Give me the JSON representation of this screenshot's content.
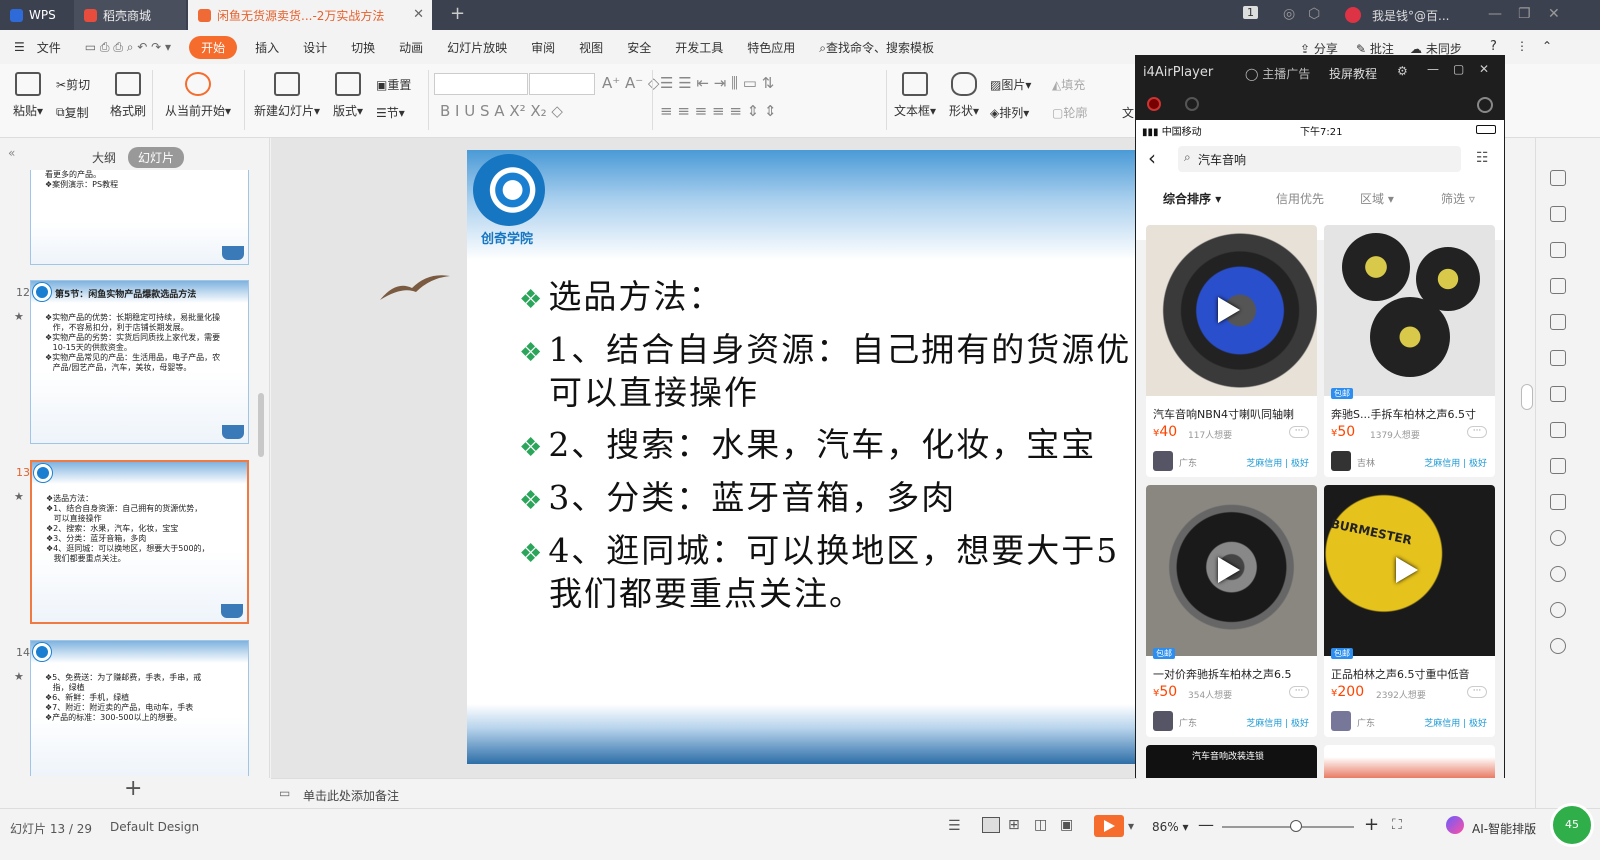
{
  "tabs": {
    "wps": "WPS",
    "store": "稻壳商城",
    "doc": "闲鱼无货源卖货...-2万实战方法"
  },
  "titlebar": {
    "user": "我是钱°@百...",
    "badge": "1"
  },
  "menu": {
    "file": "文件",
    "items": [
      "开始",
      "插入",
      "设计",
      "切换",
      "动画",
      "幻灯片放映",
      "审阅",
      "视图",
      "安全",
      "开发工具",
      "特色应用"
    ],
    "search": "查找命令、搜索模板",
    "share": "分享",
    "comment": "批注",
    "sync": "未同步"
  },
  "ribbon": {
    "paste": "粘贴",
    "cut": "剪切",
    "copy": "复制",
    "format_painter": "格式刷",
    "from_current": "从当前开始",
    "new_slide": "新建幻灯片",
    "layout": "版式",
    "reset": "重置",
    "section": "节",
    "textbox": "文本框",
    "shape": "形状",
    "picture": "图片",
    "arrange": "排列",
    "fill": "填充",
    "outline": "轮廓",
    "wen": "文"
  },
  "panel": {
    "outline_tab": "大纲",
    "slides_tab": "幻灯片",
    "slide11_lines": "看更多的产品。\n❖案例演示：PS教程",
    "slide12_num": "12",
    "slide12_title": "第5节：闲鱼实物产品爆款选品方法",
    "slide12_lines": "❖实物产品的优势：长期稳定可持续，易批量化操\n   作，不容易扣分，利于店铺长期发展。\n❖实物产品的劣势：实货后同质找上家代发，需要\n   10-15天的供款资金。\n❖实物产品常见的产品：生活用品，电子产品，农\n   产品/园艺产品，汽车，美妆，母婴等。",
    "slide13_num": "13",
    "slide13_lines": "❖选品方法：\n❖1、结合自身资源：自己拥有的货源优势，\n   可以直接操作\n❖2、搜索：水果，汽车，化妆，宝宝\n❖3、分类：蓝牙音箱，多肉\n❖4、逛同城：可以换地区，想要大于500的，\n   我们都要重点关注。",
    "slide14_num": "14",
    "slide14_lines": "❖5、免费送：为了赚邮费，手表，手串，戒\n   指，绿植\n❖6、新鲜：手机，绿植\n❖7、附近：附近卖的产品，电动车，手表\n❖产品的标准：300-500以上的想要。",
    "add_button": "+"
  },
  "slide": {
    "brand": "创奇学院",
    "lines": [
      "选品方法：",
      "1、结合自身资源：自己拥有的货源优",
      "可以直接操作",
      "2、搜索：水果，汽车，化妆，宝宝",
      "3、分类：蓝牙音箱，多肉",
      "4、逛同城：可以换地区，想要大于5",
      "我们都要重点关注。"
    ]
  },
  "notes": {
    "placeholder": "单击此处添加备注"
  },
  "status": {
    "slide_pos": "幻灯片 13 / 29",
    "theme": "Default Design",
    "zoom": "86%",
    "zoom_fraction": 0.56,
    "ai": "AI-智能排版",
    "badge": "45"
  },
  "player": {
    "title": "i4AirPlayer",
    "ad": "主播广告",
    "tutorial": "投屏教程"
  },
  "phone": {
    "carrier": "中国移动",
    "time": "下午7:21",
    "search_query": "汽车音响",
    "filters": [
      "综合排序",
      "信用优先",
      "区域",
      "筛选"
    ],
    "items": [
      {
        "title": "汽车音响NBN4寸喇叭同轴喇",
        "price": "40",
        "want": "117人想要",
        "loc": "广东",
        "credit": "芝麻信用 | 极好",
        "badge": ""
      },
      {
        "title": "奔驰S...手拆车柏林之声6.5寸",
        "price": "50",
        "want": "1379人想要",
        "loc": "吉林",
        "credit": "芝麻信用 | 极好",
        "badge": "包邮"
      },
      {
        "title": "一对价奔驰拆车柏林之声6.5",
        "price": "50",
        "want": "354人想要",
        "loc": "广东",
        "credit": "芝麻信用 | 极好",
        "badge": "包邮"
      },
      {
        "title": "正品柏林之声6.5寸重中低音",
        "price": "200",
        "want": "2392人想要",
        "loc": "广东",
        "credit": "芝麻信用 | 极好",
        "badge": "包邮"
      }
    ],
    "currency": "¥",
    "more": "···",
    "next_banner": "汽车音响改装连锁",
    "burmester": "BURMESTER"
  }
}
